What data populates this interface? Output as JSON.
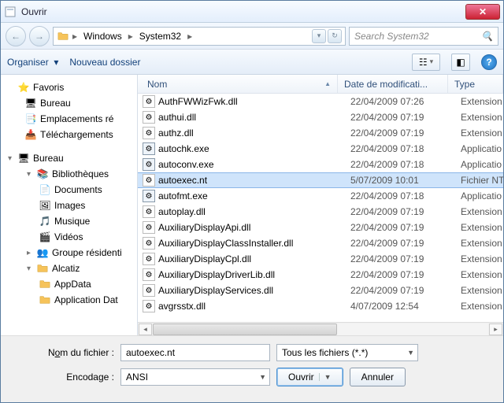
{
  "title": "Ouvrir",
  "path": {
    "segments": [
      "Windows",
      "System32"
    ]
  },
  "search": {
    "placeholder": "Search System32"
  },
  "toolbar": {
    "organize": "Organiser",
    "newfolder": "Nouveau dossier"
  },
  "columns": {
    "name": "Nom",
    "date": "Date de modificati...",
    "type": "Type"
  },
  "sidebar": {
    "favorites": {
      "label": "Favoris",
      "items": [
        "Bureau",
        "Emplacements ré",
        "Téléchargements"
      ]
    },
    "desktop": {
      "label": "Bureau",
      "libraries": {
        "label": "Bibliothèques",
        "items": [
          "Documents",
          "Images",
          "Musique",
          "Vidéos"
        ]
      },
      "homegroup": "Groupe résidenti",
      "user": {
        "label": "Alcatiz",
        "items": [
          "AppData",
          "Application Dat"
        ]
      }
    }
  },
  "files": [
    {
      "name": "AuthFWWizFwk.dll",
      "date": "22/04/2009 07:26",
      "type": "Extension",
      "kind": "dll"
    },
    {
      "name": "authui.dll",
      "date": "22/04/2009 07:19",
      "type": "Extension",
      "kind": "dll"
    },
    {
      "name": "authz.dll",
      "date": "22/04/2009 07:19",
      "type": "Extension",
      "kind": "dll"
    },
    {
      "name": "autochk.exe",
      "date": "22/04/2009 07:18",
      "type": "Applicatio",
      "kind": "exe"
    },
    {
      "name": "autoconv.exe",
      "date": "22/04/2009 07:18",
      "type": "Applicatio",
      "kind": "exe"
    },
    {
      "name": "autoexec.nt",
      "date": "5/07/2009 10:01",
      "type": "Fichier NT",
      "kind": "nt",
      "selected": true
    },
    {
      "name": "autofmt.exe",
      "date": "22/04/2009 07:18",
      "type": "Applicatio",
      "kind": "exe"
    },
    {
      "name": "autoplay.dll",
      "date": "22/04/2009 07:19",
      "type": "Extension",
      "kind": "dll"
    },
    {
      "name": "AuxiliaryDisplayApi.dll",
      "date": "22/04/2009 07:19",
      "type": "Extension",
      "kind": "dll"
    },
    {
      "name": "AuxiliaryDisplayClassInstaller.dll",
      "date": "22/04/2009 07:19",
      "type": "Extension",
      "kind": "dll"
    },
    {
      "name": "AuxiliaryDisplayCpl.dll",
      "date": "22/04/2009 07:19",
      "type": "Extension",
      "kind": "dll"
    },
    {
      "name": "AuxiliaryDisplayDriverLib.dll",
      "date": "22/04/2009 07:19",
      "type": "Extension",
      "kind": "dll"
    },
    {
      "name": "AuxiliaryDisplayServices.dll",
      "date": "22/04/2009 07:19",
      "type": "Extension",
      "kind": "dll"
    },
    {
      "name": "avgrsstx.dll",
      "date": "4/07/2009 12:54",
      "type": "Extension",
      "kind": "dll"
    }
  ],
  "footer": {
    "filename_label_pre": "N",
    "filename_label_u": "o",
    "filename_label_post": "m du fichier :",
    "filename_value": "autoexec.nt",
    "filter_value": "Tous les fichiers  (*.*)",
    "encoding_label": "Encodage :",
    "encoding_value": "ANSI",
    "open": "Ouvrir",
    "cancel": "Annuler"
  }
}
